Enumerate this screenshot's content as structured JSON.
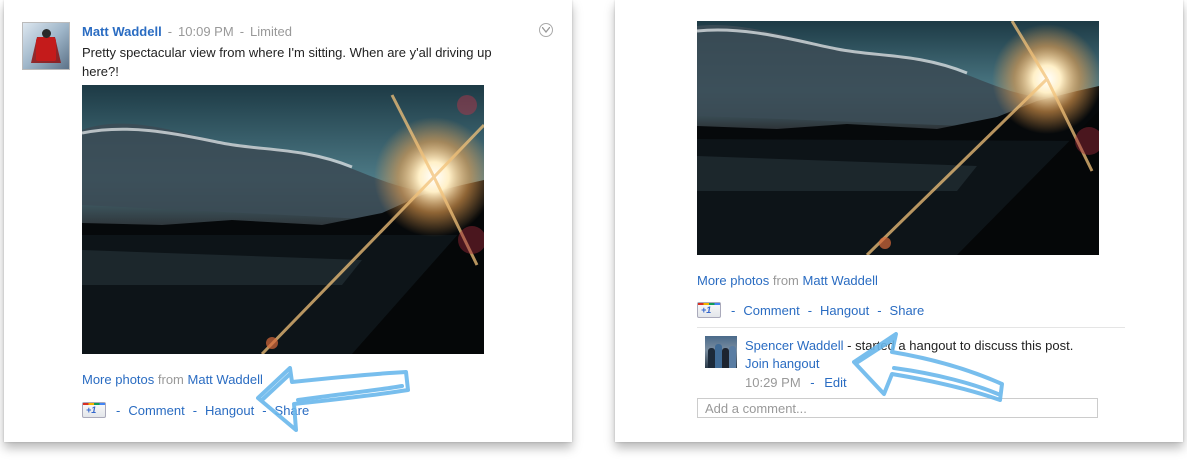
{
  "left_post": {
    "author": "Matt Waddell",
    "time": "10:09 PM",
    "visibility": "Limited",
    "text": "Pretty spectacular view from where I'm sitting. When are y'all driving up here?!",
    "more_photos_label": "More photos",
    "from_label": "from",
    "from_author": "Matt Waddell",
    "plusone_label": "+1",
    "comment_label": "Comment",
    "hangout_label": "Hangout",
    "share_label": "Share",
    "separator": "-"
  },
  "right_post": {
    "more_photos_label": "More photos",
    "from_label": "from",
    "from_author": "Matt Waddell",
    "plusone_label": "+1",
    "comment_label": "Comment",
    "hangout_label": "Hangout",
    "share_label": "Share",
    "separator": "-",
    "hangout_activity": {
      "user": "Spencer Waddell",
      "text": "- started a hangout to discuss this post.",
      "join_label": "Join hangout",
      "time": "10:29 PM",
      "edit_label": "Edit"
    },
    "comment_placeholder": "Add a comment..."
  },
  "colors": {
    "link": "#2a6cc2",
    "annotation_arrow": "#6ab8ec"
  },
  "icons": [
    "chevron-down-icon",
    "plusone-icon",
    "annotation-arrow-icon"
  ]
}
